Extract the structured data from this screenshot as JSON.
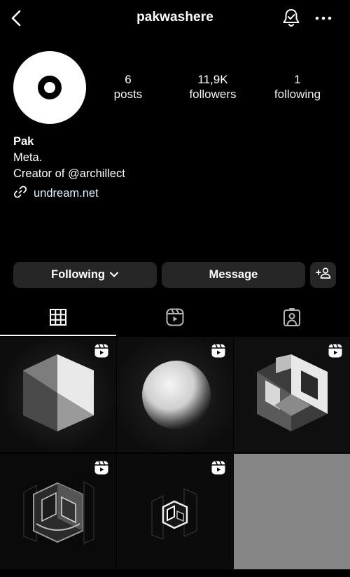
{
  "header": {
    "username": "pakwashere"
  },
  "stats": [
    {
      "value": "6",
      "label": "posts"
    },
    {
      "value": "11,9K",
      "label": "followers"
    },
    {
      "value": "1",
      "label": "following"
    }
  ],
  "bio": {
    "name": "Pak",
    "line1": "Meta.",
    "line2": "Creator of @archillect",
    "link": "undream.net"
  },
  "actions": {
    "following": "Following",
    "message": "Message"
  },
  "tabs": [
    "grid-icon",
    "reels-icon",
    "tagged-icon"
  ],
  "grid": [
    {
      "type": "reel",
      "content": "cube"
    },
    {
      "type": "reel",
      "content": "sphere"
    },
    {
      "type": "reel",
      "content": "hollow-cube"
    },
    {
      "type": "reel",
      "content": "glass-cube"
    },
    {
      "type": "reel",
      "content": "small-hollow-cube"
    },
    {
      "type": "empty",
      "content": "grey"
    }
  ],
  "colors": {
    "background": "#000000",
    "button": "#262626",
    "link": "#e0f1ff"
  }
}
